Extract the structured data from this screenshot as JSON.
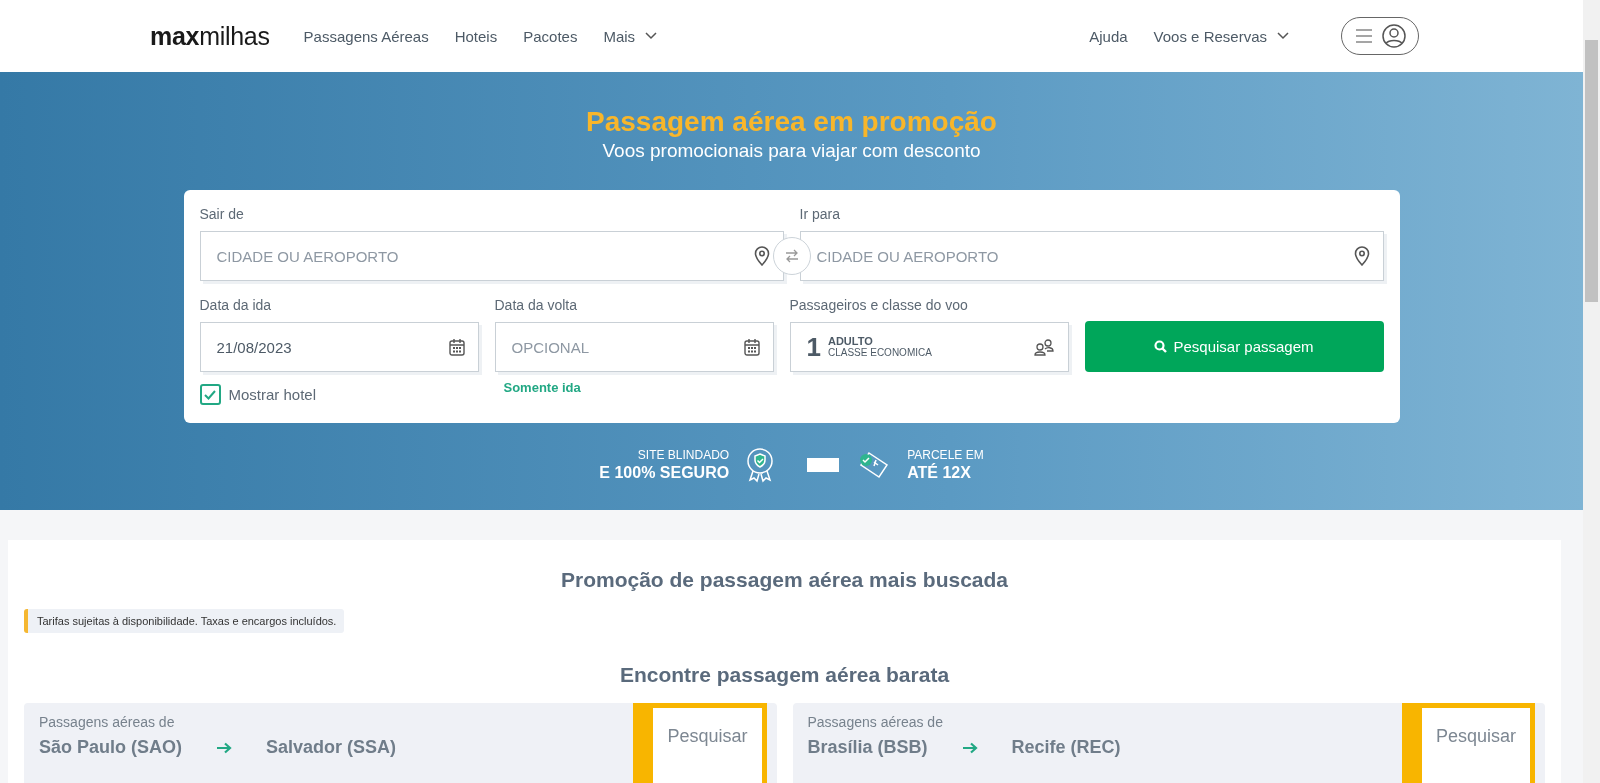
{
  "header": {
    "logo": {
      "bold": "max",
      "light": "milhas"
    },
    "nav": [
      {
        "label": "Passagens Aéreas",
        "dropdown": false
      },
      {
        "label": "Hoteis",
        "dropdown": false
      },
      {
        "label": "Pacotes",
        "dropdown": false
      },
      {
        "label": "Mais",
        "dropdown": true
      }
    ],
    "right_nav": [
      {
        "label": "Ajuda",
        "dropdown": false
      },
      {
        "label": "Voos e Reservas",
        "dropdown": true
      }
    ]
  },
  "hero": {
    "title": "Passagem aérea em promoção",
    "subtitle": "Voos promocionais para viajar com desconto"
  },
  "search_form": {
    "origin": {
      "label": "Sair de",
      "placeholder": "CIDADE OU AEROPORTO"
    },
    "destination": {
      "label": "Ir para",
      "placeholder": "CIDADE OU AEROPORTO"
    },
    "departure": {
      "label": "Data da ida",
      "value": "21/08/2023"
    },
    "return": {
      "label": "Data da volta",
      "placeholder": "OPCIONAL"
    },
    "one_way_link": "Somente ida",
    "show_hotel": {
      "label": "Mostrar hotel",
      "checked": true
    },
    "passengers": {
      "label": "Passageiros e classe do voo",
      "count": "1",
      "type": "ADULTO",
      "class": "CLASSE ECONOMICA"
    },
    "submit": "Pesquisar passagem"
  },
  "badges": [
    {
      "line1": "SITE BLINDADO",
      "line2": "E 100% SEGURO"
    },
    {
      "line1": "PARCELE EM",
      "line2": "ATÉ 12X"
    }
  ],
  "promo": {
    "title": "Promoção de passagem aérea mais buscada",
    "notice": "Tarifas sujeitas à disponibilidade. Taxas e encargos incluídos.",
    "subtitle": "Encontre passagem aérea barata",
    "routes": [
      {
        "caption": "Passagens aéreas de",
        "from": "São Paulo (SAO)",
        "to": "Salvador (SSA)",
        "button": "Pesquisar"
      },
      {
        "caption": "Passagens aéreas de",
        "from": "Brasília (BSB)",
        "to": "Recife (REC)",
        "button": "Pesquisar"
      }
    ]
  }
}
